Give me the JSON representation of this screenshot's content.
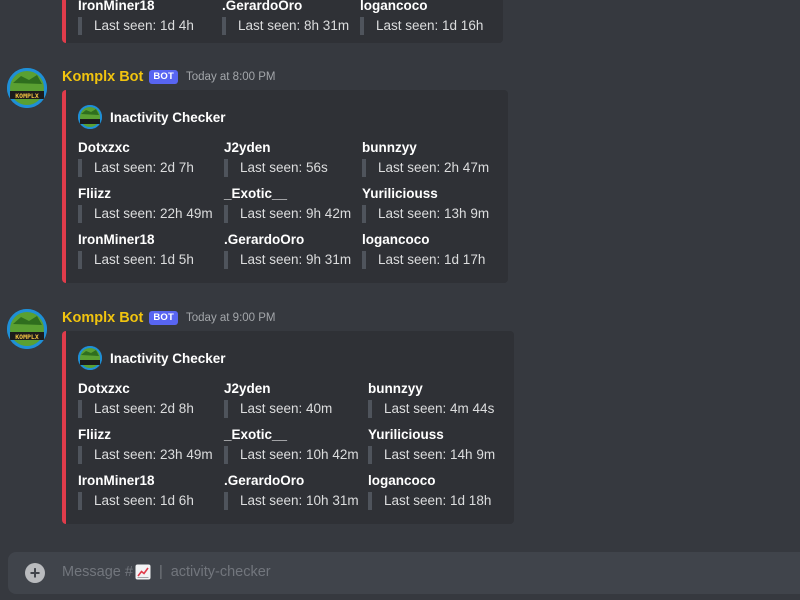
{
  "channel": {
    "composer_prefix": "Message #",
    "composer_separator": "|",
    "channel_name": "activity-checker",
    "channel_icon": "chart-increasing-icon"
  },
  "top_partial": {
    "fields": [
      {
        "name": "IronMiner18",
        "value": "Last seen: 1d 4h"
      },
      {
        "name": ".GerardoOro",
        "value": "Last seen: 8h 31m"
      },
      {
        "name": "logancoco",
        "value": "Last seen: 1d 16h"
      }
    ]
  },
  "messages": [
    {
      "author": "Komplx Bot",
      "bot_tag": "BOT",
      "timestamp": "Today at 8:00 PM",
      "embed": {
        "title": "Inactivity Checker",
        "fields": [
          {
            "name": "Dotxzxc",
            "value": "Last seen: 2d 7h"
          },
          {
            "name": "J2yden",
            "value": "Last seen: 56s"
          },
          {
            "name": "bunnzyy",
            "value": "Last seen: 2h 47m"
          },
          {
            "name": "Fliizz",
            "value": "Last seen: 22h 49m"
          },
          {
            "name": "_Exotic__",
            "value": "Last seen: 9h 42m"
          },
          {
            "name": "Yuriliciouss",
            "value": "Last seen: 13h 9m"
          },
          {
            "name": "IronMiner18",
            "value": "Last seen: 1d 5h"
          },
          {
            "name": ".GerardoOro",
            "value": "Last seen: 9h 31m"
          },
          {
            "name": "logancoco",
            "value": "Last seen: 1d 17h"
          }
        ]
      }
    },
    {
      "author": "Komplx Bot",
      "bot_tag": "BOT",
      "timestamp": "Today at 9:00 PM",
      "embed": {
        "title": "Inactivity Checker",
        "fields": [
          {
            "name": "Dotxzxc",
            "value": "Last seen: 2d 8h"
          },
          {
            "name": "J2yden",
            "value": "Last seen: 40m"
          },
          {
            "name": "bunnzyy",
            "value": "Last seen: 4m 44s"
          },
          {
            "name": "Fliizz",
            "value": "Last seen: 23h 49m"
          },
          {
            "name": "_Exotic__",
            "value": "Last seen: 10h 42m"
          },
          {
            "name": "Yuriliciouss",
            "value": "Last seen: 14h 9m"
          },
          {
            "name": "IronMiner18",
            "value": "Last seen: 1d 6h"
          },
          {
            "name": ".GerardoOro",
            "value": "Last seen: 10h 31m"
          },
          {
            "name": "logancoco",
            "value": "Last seen: 1d 18h"
          }
        ]
      }
    }
  ],
  "colors": {
    "background": "#36393f",
    "embed_background": "#2f3136",
    "embed_accent": "#e03c4b",
    "author_color": "#f1c40f",
    "bot_tag_color": "#5865f2"
  }
}
